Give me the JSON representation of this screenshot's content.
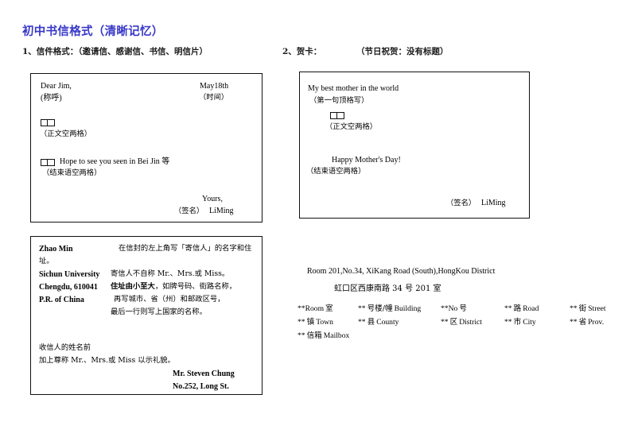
{
  "title": "初中书信格式（清晰记忆）",
  "sections": [
    {
      "number": "1、信件格式：（邀请信、感谢信、书信、明信片）"
    },
    {
      "number": "2、贺卡：",
      "extra": "（节日祝贺：没有标题）"
    }
  ],
  "letter_box": {
    "salutation": "Dear   Jim,",
    "salutation_note": "(称呼)",
    "date": "May18th",
    "date_note": "（时间）",
    "body_note": "（正文空两格）",
    "closing_line": "Hope    to see    you     seen    in Bei Jin 等",
    "closing_note": "（结束语空两格）",
    "yours": "Yours,",
    "sign_note": "（签名）",
    "sign_name": "LiMing"
  },
  "card_box": {
    "first_line": "My    best    mother in the world",
    "first_line_note": "（第一句顶格写）",
    "body_note": "（正文空两格）",
    "greeting": "Happy    Mother's    Day!",
    "closing_note": "（结束语空两格）",
    "sign_note": "（签名）",
    "sign_name": "LiMing"
  },
  "envelope_box": {
    "sender": [
      "Zhao Min",
      "Sichun University",
      "Chengdu, 610041",
      "P.R. of China"
    ],
    "notes": [
      "在信封的左上角写「寄信人」的名字和住",
      "址。",
      "寄信人不自称 Mr.、Mrs.或 Miss。",
      "住址由小至大，如牌号码、街路名称，",
      "再写城市、省（州）和邮政区号，",
      "最后一行则写上国家的名称。"
    ],
    "note_bold_fragment": "由小至大",
    "note_prefix_fragment": "住址",
    "note_suffix_fragment": "，如牌号码、街路名称，",
    "recipient_notes": [
      "收信人的姓名前",
      "加上尊称 Mr.、Mrs.或 Miss 以示礼貌。"
    ],
    "recipient": [
      "Mr. Steven Chung",
      "No.252, Long St."
    ]
  },
  "address_sample": {
    "english": "Room 201,No.34, XiKang Road (South),HongKou District",
    "chinese": "虹口区西康南路 34 号 201 室"
  },
  "abbreviations": [
    [
      {
        "stars": "**",
        "latin": "Room",
        "zh": "室",
        "order": "latin-first"
      },
      {
        "stars": "**",
        "zh": "号楼/幢",
        "latin": "Building",
        "order": "zh-first"
      },
      {
        "stars": "**",
        "latin": "No",
        "zh": "号",
        "order": "latin-first"
      },
      {
        "stars": "**",
        "zh": "路",
        "latin": "Road",
        "order": "zh-first"
      },
      {
        "stars": "**",
        "zh": "街",
        "latin": "Street",
        "order": "zh-first"
      }
    ],
    [
      {
        "stars": "**",
        "zh": "镇",
        "latin": "Town",
        "order": "zh-first"
      },
      {
        "stars": "**",
        "zh": "县",
        "latin": "County",
        "order": "zh-first"
      },
      {
        "stars": "**",
        "zh": "区",
        "latin": "District",
        "order": "zh-first"
      },
      {
        "stars": "**",
        "zh": "市",
        "latin": "City",
        "order": "zh-first"
      },
      {
        "stars": "**",
        "zh": "省",
        "latin": "Prov.",
        "order": "zh-first"
      }
    ],
    [
      {
        "stars": "**",
        "zh": "信箱",
        "latin": "Mailbox",
        "order": "zh-first"
      }
    ]
  ],
  "colors": {
    "title": "#3838c8",
    "text": "#000000",
    "border": "#111111"
  }
}
